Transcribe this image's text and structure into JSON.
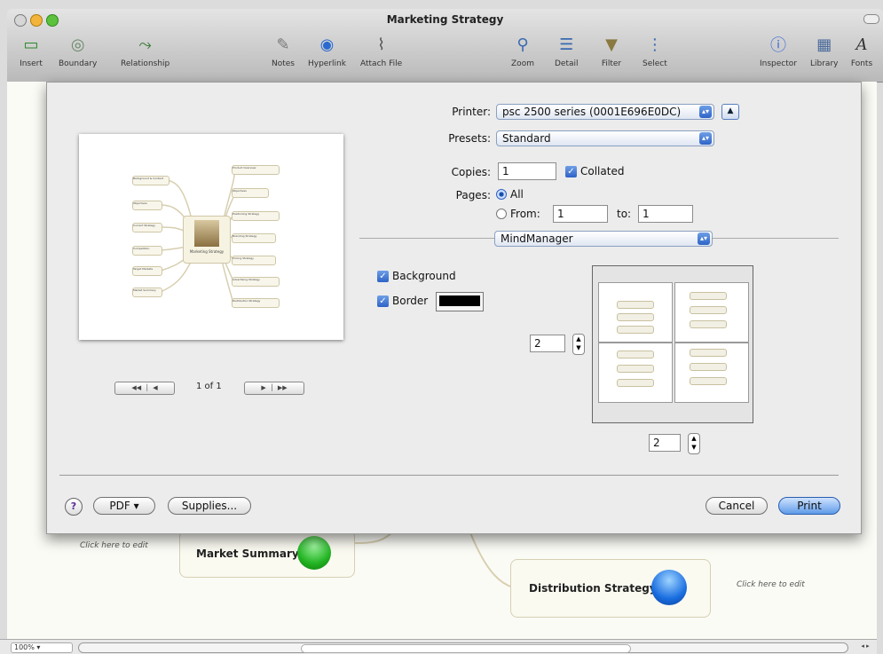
{
  "window": {
    "title": "Marketing Strategy"
  },
  "toolbar": {
    "items": [
      {
        "label": "Insert",
        "icon": "insert-icon"
      },
      {
        "label": "Boundary",
        "icon": "boundary-icon"
      },
      {
        "label": "Relationship",
        "icon": "relationship-icon"
      },
      {
        "label": "Notes",
        "icon": "notes-icon"
      },
      {
        "label": "Hyperlink",
        "icon": "hyperlink-icon"
      },
      {
        "label": "Attach File",
        "icon": "paperclip-icon"
      },
      {
        "label": "Zoom",
        "icon": "zoom-icon"
      },
      {
        "label": "Detail",
        "icon": "detail-icon"
      },
      {
        "label": "Filter",
        "icon": "filter-icon"
      },
      {
        "label": "Select",
        "icon": "select-icon"
      },
      {
        "label": "Inspector",
        "icon": "info-icon"
      },
      {
        "label": "Library",
        "icon": "library-icon"
      },
      {
        "label": "Fonts",
        "icon": "fonts-icon"
      }
    ]
  },
  "canvas": {
    "central_topic": "Marketing Strategy",
    "topics": {
      "market_summary": "Market Summary",
      "distribution": "Distribution Strategy",
      "positioning": "Positioning",
      "branding": "Branding",
      "pricing": "Pricing Strategy",
      "advertising": "Advertising Strategy",
      "competition": "Competition",
      "target": "Target Markets"
    },
    "hint": "Click here to edit"
  },
  "print": {
    "printer_label": "Printer:",
    "printer_value": "psc 2500 series (0001E696E0DC)",
    "presets_label": "Presets:",
    "presets_value": "Standard",
    "copies_label": "Copies:",
    "copies_value": "1",
    "collated_label": "Collated",
    "pages_label": "Pages:",
    "all_label": "All",
    "from_label": "From:",
    "from_value": "1",
    "to_label": "to:",
    "to_value": "1",
    "section_value": "MindManager",
    "background_label": "Background",
    "border_label": "Border",
    "border_color": "#000000",
    "tiles_across": "2",
    "tiles_down": "2",
    "page_indicator": "1 of 1",
    "help_label": "?",
    "pdf_label": "PDF ▾",
    "supplies_label": "Supplies...",
    "cancel_label": "Cancel",
    "print_label": "Print"
  },
  "statusbar": {
    "zoom": "100%"
  },
  "preview_nodes": {
    "center": "Marketing Strategy",
    "left": [
      "Background & Context",
      "Objectives",
      "Current Strategy",
      "Competition",
      "Target Markets",
      "Market Summary"
    ],
    "right": [
      "Product Overview",
      "Objectives",
      "Positioning Strategy",
      "Branding Strategy",
      "Pricing Strategy",
      "Advertising Strategy",
      "Distribution Strategy"
    ]
  },
  "colors": {
    "accent": "#3a78d8",
    "green_ball": "#22b322",
    "blue_ball": "#1a6ee0"
  }
}
